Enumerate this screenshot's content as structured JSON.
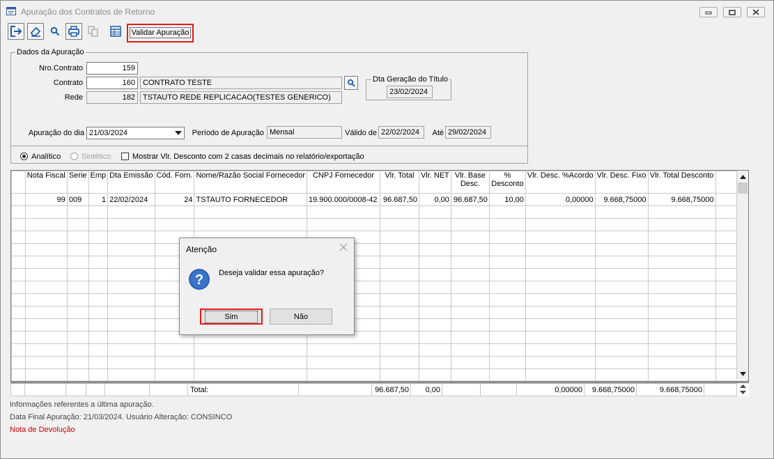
{
  "window": {
    "title": "Apuração dos Contratos de Retorno"
  },
  "toolbar": {
    "validar_label": "Validar Apuração"
  },
  "dados": {
    "legend": "Dados da Apuração",
    "nro_contrato_label": "Nro.Contrato",
    "nro_contrato_value": "159",
    "contrato_label": "Contrato",
    "contrato_value": "160",
    "contrato_name": "CONTRATO TESTE",
    "rede_label": "Rede",
    "rede_value": "182",
    "rede_name": "TSTAUTO REDE REPLICACAO(TESTES GENERICO)",
    "dta_geracao_legend": "Dta Geração do Título",
    "dta_geracao_value": "23/02/2024",
    "apuracao_dia_label": "Apuração do dia",
    "apuracao_dia_value": "21/03/2024",
    "periodo_label": "Período de Apuração",
    "periodo_value": "Mensal",
    "valido_label": "Válido de",
    "valido_value": "22/02/2024",
    "ate_label": "Até",
    "ate_value": "29/02/2024"
  },
  "options": {
    "analitico": "Analítico",
    "sintetico": "Sintético",
    "mostrar": "Mostrar Vlr. Desconto com 2 casas decimais no relatório/exportação"
  },
  "table": {
    "headers": [
      "Nota Fiscal",
      "Serie",
      "Emp",
      "Dta Emissão",
      "Cód. Forn.",
      "Nome/Razão Social Fornecedor",
      "CNPJ Fornecedor",
      "Vlr. Total",
      "Vlr. NET",
      "Vlr. Base Desc.",
      "% Desconto",
      "Vlr. Desc. %Acordo",
      "Vlr. Desc. Fixo",
      "Vlr. Total Desconto"
    ],
    "row": [
      "99",
      "009",
      "1",
      "22/02/2024",
      "24",
      "TSTAUTO FORNECEDOR",
      "19.900.000/0008-42",
      "96.687,50",
      "0,00",
      "96.687,50",
      "10,00",
      "0,00000",
      "9.668,75000",
      "9.668,75000"
    ],
    "totals": {
      "label": "Total:",
      "vlr_total": "96.687,50",
      "vlr_net": "0,00",
      "desc_acordo": "0,00000",
      "desc_fixo": "9.668,75000",
      "total_desc": "9.668,75000"
    }
  },
  "info": {
    "line1": "Informações referentes a última apuração.",
    "line2": "Data Final Apuração: 21/03/2024. Usuário Alteração: CONSINCO",
    "line3": "Nota de Devolução"
  },
  "dialog": {
    "title": "Atenção",
    "message": "Deseja validar essa apuração?",
    "yes": "Sim",
    "no": "Não"
  },
  "colors": {
    "highlight": "#e01a1a",
    "link_red": "#cc0000",
    "icon_blue": "#1f5fa8"
  }
}
